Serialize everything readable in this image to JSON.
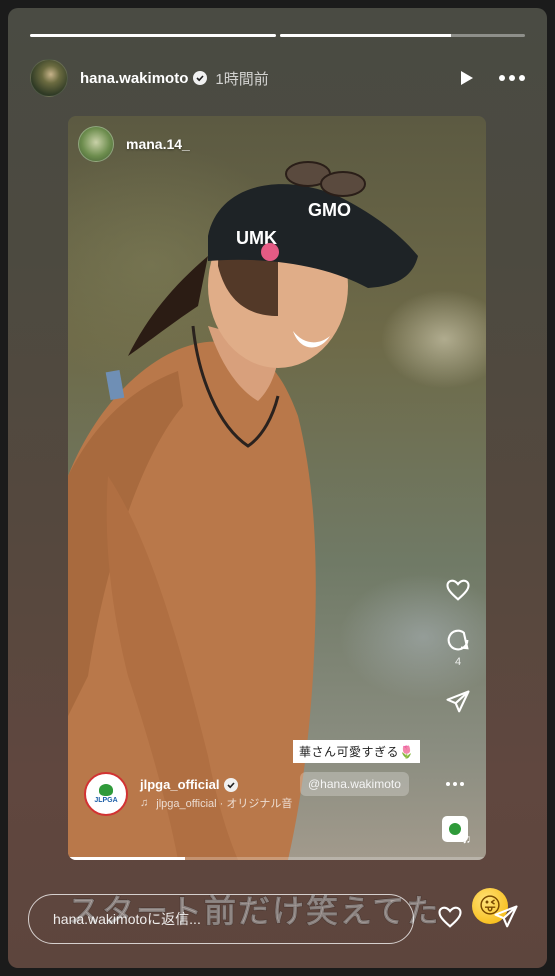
{
  "story": {
    "progress": [
      1.0,
      0.7
    ],
    "author": "hana.wakimoto",
    "time": "1時間前"
  },
  "reel": {
    "user": "mana.14_",
    "like_count": "",
    "comment_count": "4",
    "caption_sticker": "華さん可愛すぎる🌷",
    "mention": "@hana.wakimoto",
    "author": "jlpga_official",
    "audio": "jlpga_official · オリジナル音",
    "logo_text": "JLPGA"
  },
  "overlay_text": "スタート前だけ笑えてた",
  "reply": {
    "placeholder": "hana.wakimotoに返信..."
  },
  "icons": {
    "header": [
      "play-icon",
      "more-icon"
    ],
    "reel_side": [
      "heart-icon",
      "comment-icon",
      "share-icon"
    ],
    "reply_actions": [
      "heart-icon",
      "send-icon"
    ]
  }
}
